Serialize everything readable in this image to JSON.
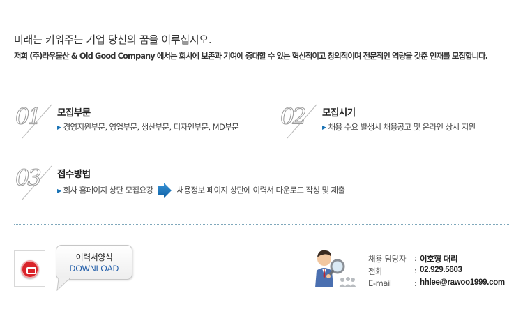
{
  "intro": {
    "headline": "미래는 키워주는 기업 당신의 꿈을 이루십시오.",
    "subline": "저희 (주)라우물산 & Old Good Company 에서는 회사에 보존과 기여에 증대할 수 있는 혁신적이고 창의적이며 전문적인 역량을 갖춘 인재를 모집합니다."
  },
  "steps": [
    {
      "number": "01",
      "title": "모집부문",
      "desc": "경영지원부문, 영업부문, 생산부문, 디자인부문, MD부문"
    },
    {
      "number": "02",
      "title": "모집시기",
      "desc": "채용 수요 발생시 채용공고 및 온라인 상시 지원"
    },
    {
      "number": "03",
      "title": "접수방법",
      "desc_part1": "회사 홈페이지 상단 모집요강",
      "desc_part2": "채용정보 페이지 상단에 이력서 다운로드 작성 및 제출"
    }
  ],
  "download": {
    "line1": "이력서양식",
    "line2": "DOWNLOAD"
  },
  "contact": {
    "rows": [
      {
        "label": "채용 담당자",
        "colon": ":",
        "value": "이호형 대리"
      },
      {
        "label": "전화",
        "colon": ":",
        "value": "02.929.5603"
      },
      {
        "label": "E-mail",
        "colon": ":",
        "value": "hhlee@rawoo1999.com"
      }
    ]
  },
  "colors": {
    "accent_blue": "#1a73b5",
    "pdf_red": "#d9242a",
    "divider": "#7fa8bb"
  },
  "icons": [
    "pdf-icon",
    "speech-bubble",
    "search-person-icon",
    "blue-arrow-icon"
  ]
}
